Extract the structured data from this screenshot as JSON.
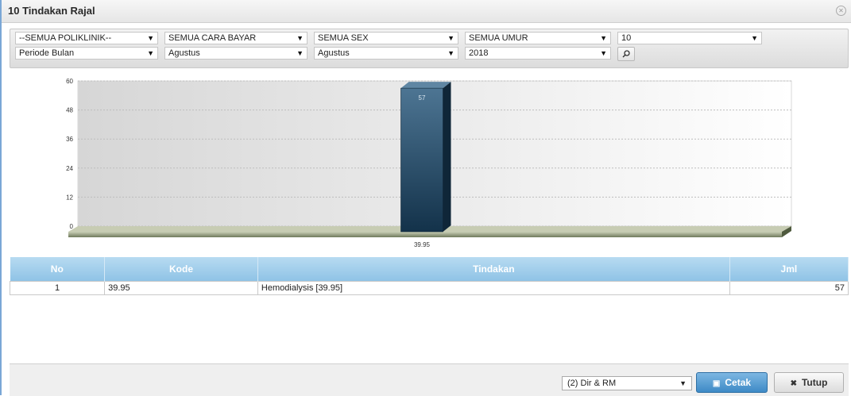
{
  "window": {
    "title": "10 Tindakan Rajal",
    "close_icon": "close-circle-icon"
  },
  "filters": {
    "row1": [
      {
        "name": "poliklinik-select",
        "value": "--SEMUA POLIKLINIK--"
      },
      {
        "name": "cara-bayar-select",
        "value": "SEMUA CARA BAYAR"
      },
      {
        "name": "sex-select",
        "value": "SEMUA SEX"
      },
      {
        "name": "umur-select",
        "value": "SEMUA UMUR"
      },
      {
        "name": "top-n-select",
        "value": "10"
      }
    ],
    "row2": [
      {
        "name": "periode-select",
        "value": "Periode Bulan"
      },
      {
        "name": "bulan-awal-select",
        "value": "Agustus"
      },
      {
        "name": "bulan-akhir-select",
        "value": "Agustus"
      },
      {
        "name": "tahun-select",
        "value": "2018"
      }
    ],
    "search_icon": "search-icon"
  },
  "chart_data": {
    "type": "bar",
    "categories": [
      "39.95"
    ],
    "values": [
      57
    ],
    "ylim": [
      0,
      60
    ],
    "yticks": [
      "60",
      "48",
      "36",
      "24",
      "12",
      "0"
    ],
    "data_labels": [
      "57"
    ],
    "grid": true,
    "colors": {
      "bar": "#2b4d66",
      "bar_top": "#5f86a3"
    }
  },
  "table": {
    "headers": [
      "No",
      "Kode",
      "Tindakan",
      "Jml"
    ],
    "rows": [
      [
        "1",
        "39.95",
        "Hemodialysis [39.95]",
        "57"
      ]
    ]
  },
  "footer": {
    "print_option": "(2) Dir & RM",
    "cetak_label": "Cetak",
    "tutup_label": "Tutup",
    "print_icon": "printer-icon",
    "close_icon": "x-icon"
  }
}
